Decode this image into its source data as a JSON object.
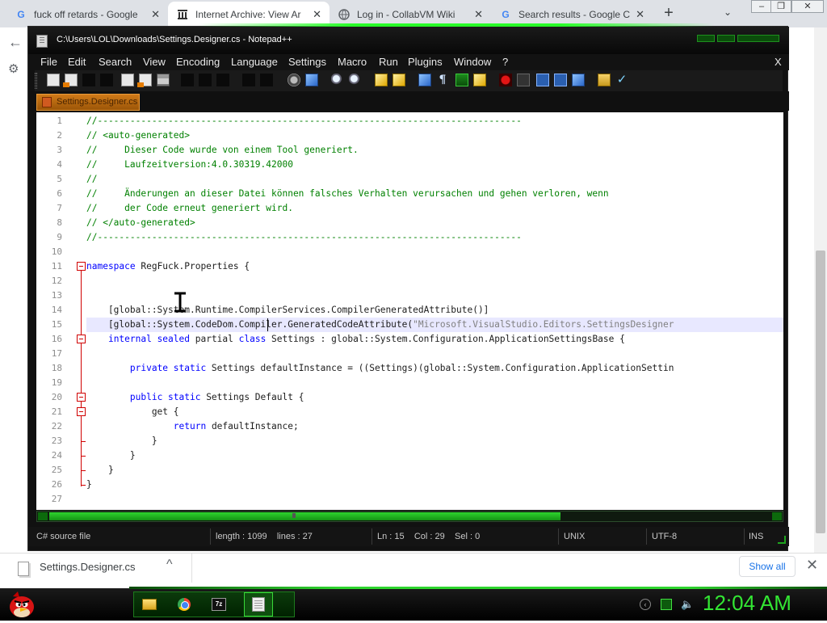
{
  "browser": {
    "tabs": [
      {
        "title": "fuck off retards - Google",
        "favicon": "google-icon",
        "active": false
      },
      {
        "title": "Internet Archive: View Ar",
        "favicon": "archive-icon",
        "active": true
      },
      {
        "title": "Log in - CollabVM Wiki",
        "favicon": "globe-icon",
        "active": false
      },
      {
        "title": "Search results - Google C",
        "favicon": "google-icon",
        "active": false
      }
    ],
    "new_tab_label": "+",
    "close_label": "✕",
    "tab_search_label": "⌄",
    "back_label": "←",
    "downloads": {
      "file_name": "Settings.Designer.cs",
      "chevron": "^",
      "show_all": "Show all",
      "close": "✕"
    }
  },
  "notepadpp": {
    "title": "C:\\Users\\LOL\\Downloads\\Settings.Designer.cs - Notepad++",
    "menu": [
      "File",
      "Edit",
      "Search",
      "View",
      "Encoding",
      "Language",
      "Settings",
      "Macro",
      "Run",
      "Plugins",
      "Window",
      "?"
    ],
    "menu_close": "X",
    "toolbar_icons": [
      "new-file-icon",
      "open-file-icon",
      "save-icon",
      "save-all-icon",
      "close-icon",
      "close-all-icon",
      "print-icon",
      "cut-icon",
      "copy-icon",
      "paste-icon",
      "undo-icon",
      "redo-icon",
      "find-icon",
      "replace-icon",
      "zoom-in-icon",
      "zoom-out-icon",
      "sync-v-icon",
      "sync-h-icon",
      "word-wrap-icon",
      "show-all-chars-icon",
      "indent-guide-icon",
      "doc-map-icon",
      "record-macro-icon",
      "stop-macro-icon",
      "play-macro-icon",
      "run-macro-multiple-icon",
      "save-macro-icon",
      "open-folder-icon",
      "spellcheck-icon"
    ],
    "doc_tab": "Settings.Designer.cs",
    "lines": [
      [
        {
          "t": "//------------------------------------------------------------------------------",
          "c": "cmt"
        }
      ],
      [
        {
          "t": "// <auto-generated>",
          "c": "cmt"
        }
      ],
      [
        {
          "t": "//     Dieser Code wurde von einem Tool generiert.",
          "c": "cmt"
        }
      ],
      [
        {
          "t": "//     Laufzeitversion:4.0.30319.42000",
          "c": "cmt"
        }
      ],
      [
        {
          "t": "//",
          "c": "cmt"
        }
      ],
      [
        {
          "t": "//     Änderungen an dieser Datei können falsches Verhalten verursachen und gehen verloren, wenn",
          "c": "cmt"
        }
      ],
      [
        {
          "t": "//     der Code erneut generiert wird.",
          "c": "cmt"
        }
      ],
      [
        {
          "t": "// </auto-generated>",
          "c": "cmt"
        }
      ],
      [
        {
          "t": "//------------------------------------------------------------------------------",
          "c": "cmt"
        }
      ],
      [],
      [
        {
          "t": "namespace",
          "c": "kw"
        },
        {
          "t": " RegFuck.Properties {",
          "c": ""
        }
      ],
      [],
      [],
      [
        {
          "t": "    [global::System.Runtime.CompilerServices.CompilerGeneratedAttribute()]",
          "c": ""
        }
      ],
      [
        {
          "t": "    [global::System.CodeDom.Compiler.GeneratedCodeAttribute(",
          "c": ""
        },
        {
          "t": "\"Microsoft.VisualStudio.Editors.SettingsDesigner",
          "c": "str"
        }
      ],
      [
        {
          "t": "    ",
          "c": ""
        },
        {
          "t": "internal sealed",
          "c": "kw"
        },
        {
          "t": " partial ",
          "c": ""
        },
        {
          "t": "class",
          "c": "kw"
        },
        {
          "t": " Settings : global::System.Configuration.ApplicationSettingsBase {",
          "c": ""
        }
      ],
      [],
      [
        {
          "t": "        ",
          "c": ""
        },
        {
          "t": "private static",
          "c": "kw"
        },
        {
          "t": " Settings defaultInstance = ((Settings)(global::System.Configuration.ApplicationSettin",
          "c": ""
        }
      ],
      [],
      [
        {
          "t": "        ",
          "c": ""
        },
        {
          "t": "public static",
          "c": "kw"
        },
        {
          "t": " Settings Default {",
          "c": ""
        }
      ],
      [
        {
          "t": "            get {",
          "c": ""
        }
      ],
      [
        {
          "t": "                ",
          "c": ""
        },
        {
          "t": "return",
          "c": "kw"
        },
        {
          "t": " defaultInstance;",
          "c": ""
        }
      ],
      [
        {
          "t": "            }",
          "c": ""
        }
      ],
      [
        {
          "t": "        }",
          "c": ""
        }
      ],
      [
        {
          "t": "    }",
          "c": ""
        }
      ],
      [
        {
          "t": "}",
          "c": ""
        }
      ],
      []
    ],
    "active_line": 15,
    "fold_markers": [
      11,
      16,
      20,
      21
    ],
    "status": {
      "type": "C# source file",
      "length": "length : 1099    lines : 27",
      "position": "Ln : 15    Col : 29    Sel : 0",
      "eol": "UNIX",
      "encoding": "UTF-8",
      "mode": "INS"
    }
  },
  "taskbar": {
    "apps": [
      "file-explorer-icon",
      "chrome-icon",
      "7zip-icon",
      "notepadpp-icon"
    ],
    "seven_zip_label": "7z",
    "tray_arrow": "‹",
    "volume": "🔈",
    "clock": "12:04 AM"
  },
  "colors": {
    "accent_green": "#2ed52e",
    "comment": "#008000",
    "keyword": "#0000ff",
    "string": "#808080"
  }
}
